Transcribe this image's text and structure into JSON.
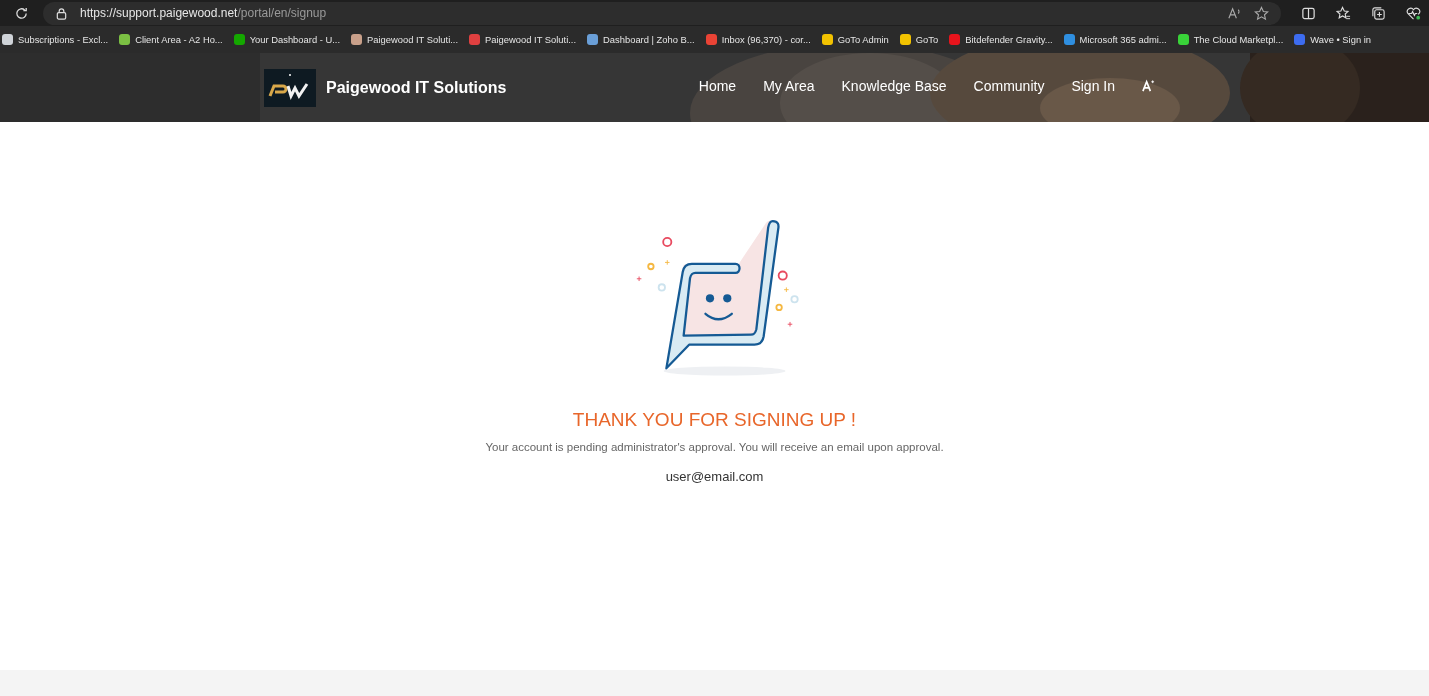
{
  "browser": {
    "url_host": "https://support.paigewood.net",
    "url_path": "/portal/en/signup"
  },
  "bookmarks": [
    "Subscriptions - Excl...",
    "Client Area - A2 Ho...",
    "Your Dashboard - U...",
    "Paigewood IT Soluti...",
    "Paigewood IT Soluti...",
    "Dashboard | Zoho B...",
    "Inbox (96,370) - cor...",
    "GoTo Admin",
    "GoTo",
    "Bitdefender Gravity...",
    "Microsoft 365 admi...",
    "The Cloud Marketpl...",
    "Wave • Sign in"
  ],
  "header": {
    "site_name": "Paigewood IT Solutions",
    "nav": [
      "Home",
      "My Area",
      "Knowledge Base",
      "Community",
      "Sign In"
    ]
  },
  "message": {
    "title": "THANK YOU FOR SIGNING UP !",
    "text": "Your account is pending administrator's approval. You will receive an email upon approval.",
    "email": "user@email.com"
  }
}
